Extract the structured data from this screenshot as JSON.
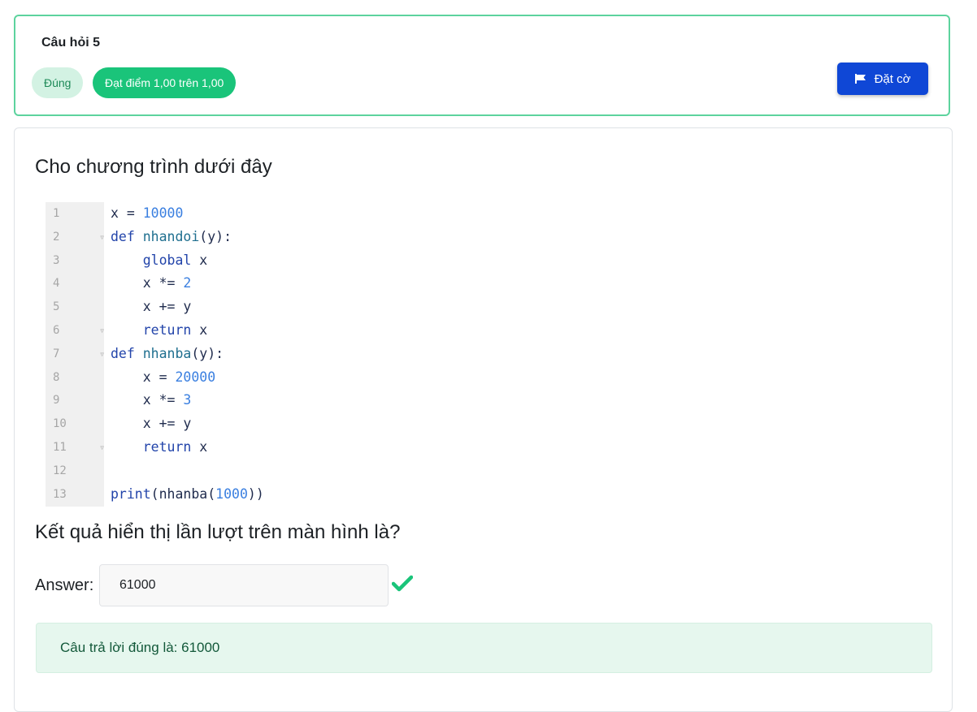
{
  "question": {
    "title": "Câu hỏi 5",
    "state": "Đúng",
    "grade": "Đạt điểm 1,00 trên 1,00",
    "flag_label": "Đặt cờ"
  },
  "content": {
    "intro": "Cho chương trình dưới đây",
    "prompt": "Kết quả hiển thị lần lượt trên màn hình là?",
    "answer_label": "Answer:",
    "answer_value": "61000",
    "feedback": "Câu trả lời đúng là: 61000"
  },
  "code": {
    "lines": [
      {
        "n": "1",
        "t": "x = 10000"
      },
      {
        "n": "2",
        "t": "def nhandoi(y):"
      },
      {
        "n": "3",
        "t": "    global x"
      },
      {
        "n": "4",
        "t": "    x *= 2"
      },
      {
        "n": "5",
        "t": "    x += y"
      },
      {
        "n": "6",
        "t": "    return x"
      },
      {
        "n": "7",
        "t": "def nhanba(y):"
      },
      {
        "n": "8",
        "t": "    x = 20000"
      },
      {
        "n": "9",
        "t": "    x *= 3"
      },
      {
        "n": "10",
        "t": "    x += y"
      },
      {
        "n": "11",
        "t": "    return x"
      },
      {
        "n": "12",
        "t": ""
      },
      {
        "n": "13",
        "t": "print(nhanba(1000))"
      }
    ]
  },
  "colors": {
    "correct_border": "#5dd39e",
    "grade_badge": "#1ac47a",
    "flag_button": "#0f47d6",
    "check_icon": "#1ac47a"
  },
  "icons": {
    "flag": "flag-icon",
    "check": "check-icon"
  }
}
